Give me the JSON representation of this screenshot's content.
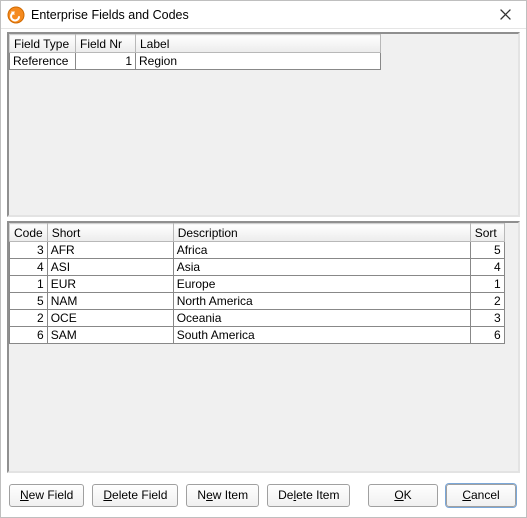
{
  "window": {
    "title": "Enterprise Fields and Codes"
  },
  "fields_grid": {
    "headers": {
      "field_type": "Field Type",
      "field_nr": "Field Nr",
      "label": "Label"
    },
    "rows": [
      {
        "field_type": "Reference",
        "field_nr": "1",
        "label": "Region"
      }
    ]
  },
  "codes_grid": {
    "headers": {
      "code": "Code",
      "short": "Short",
      "description": "Description",
      "sort": "Sort"
    },
    "rows": [
      {
        "code": "3",
        "short": "AFR",
        "description": "Africa",
        "sort": "5"
      },
      {
        "code": "4",
        "short": "ASI",
        "description": "Asia",
        "sort": "4"
      },
      {
        "code": "1",
        "short": "EUR",
        "description": "Europe",
        "sort": "1"
      },
      {
        "code": "5",
        "short": "NAM",
        "description": "North America",
        "sort": "2"
      },
      {
        "code": "2",
        "short": "OCE",
        "description": "Oceania",
        "sort": "3"
      },
      {
        "code": "6",
        "short": "SAM",
        "description": "South America",
        "sort": "6"
      }
    ]
  },
  "buttons": {
    "new_field": {
      "pre": "",
      "u": "N",
      "post": "ew Field"
    },
    "delete_field": {
      "pre": "",
      "u": "D",
      "post": "elete Field"
    },
    "new_item": {
      "pre": "N",
      "u": "e",
      "post": "w Item"
    },
    "delete_item": {
      "pre": "De",
      "u": "l",
      "post": "ete Item"
    },
    "ok": {
      "pre": "",
      "u": "O",
      "post": "K"
    },
    "cancel": {
      "pre": "",
      "u": "C",
      "post": "ancel"
    }
  }
}
